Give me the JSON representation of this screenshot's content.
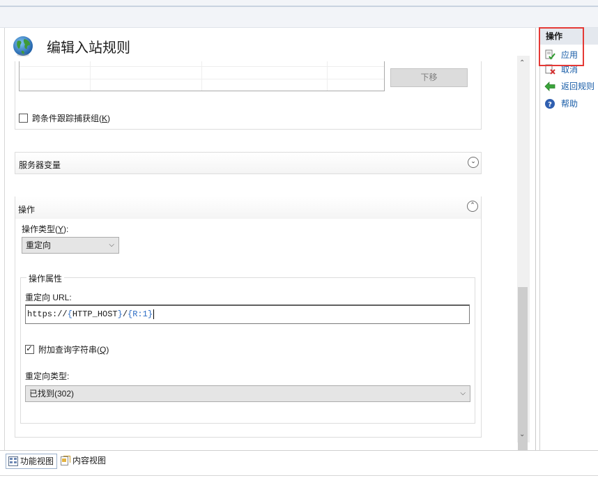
{
  "header": {
    "title": "编辑入站规则",
    "icon": "globe-icon"
  },
  "rules_grid": {
    "move_down_label": "下移"
  },
  "track_across_conditions": {
    "label": "跨条件跟踪捕获组(",
    "accelerator": "K",
    "suffix": ")",
    "checked": false
  },
  "server_variables": {
    "title": "服务器变量",
    "expanded": false
  },
  "action": {
    "title": "操作",
    "expanded": true,
    "action_type_label": "操作类型(",
    "action_type_accel": "Y",
    "action_type_suffix": "):",
    "action_type_value": "重定向",
    "properties_legend": "操作属性",
    "redirect_url_label": "重定向 URL:",
    "redirect_url": {
      "p1": "https://",
      "b1": "{",
      "p2": "HTTP_HOST",
      "b2": "}",
      "p3": "/",
      "b3": "{",
      "p4": "R:1",
      "b4": "}"
    },
    "append_query_label": "附加查询字符串(",
    "append_query_accel": "Q",
    "append_query_suffix": ")",
    "append_query_checked": true,
    "redirect_type_label": "重定向类型:",
    "redirect_type_value": "已找到(302)"
  },
  "bottom_tabs": [
    {
      "label": "功能视图",
      "active": true,
      "icon": "features-view-icon"
    },
    {
      "label": "内容视图",
      "active": false,
      "icon": "content-view-icon"
    }
  ],
  "actions_pane": {
    "title": "操作",
    "items": [
      {
        "label": "应用",
        "icon": "apply-icon"
      },
      {
        "label": "取消",
        "icon": "cancel-icon"
      },
      {
        "label": "返回规则",
        "icon": "back-arrow-icon"
      },
      {
        "label": "帮助",
        "icon": "help-icon"
      }
    ]
  },
  "colors": {
    "highlight": "#e53935",
    "link": "#1a5ea8",
    "accent": "#2b6cc4"
  }
}
